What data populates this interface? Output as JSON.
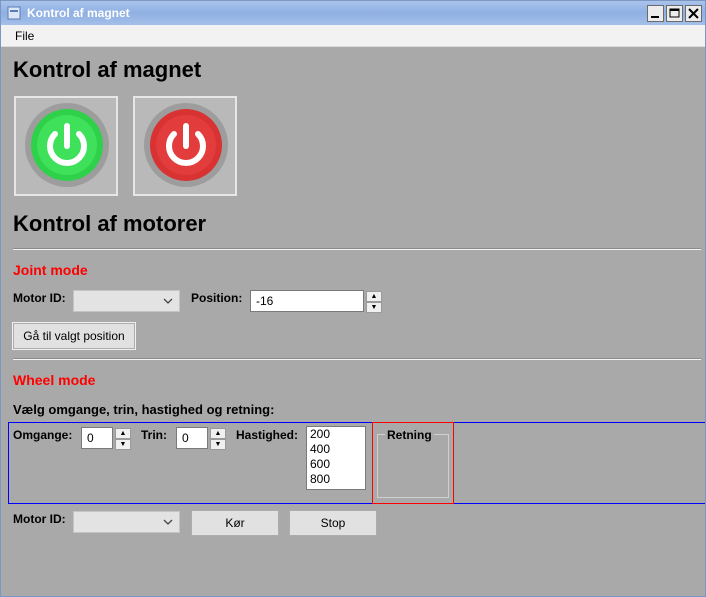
{
  "window": {
    "title": "Kontrol af magnet"
  },
  "menu": {
    "file": "File"
  },
  "magnet": {
    "heading": "Kontrol af magnet",
    "on_color": "#2fd14a",
    "off_color": "#e03a3a"
  },
  "motors": {
    "heading": "Kontrol af motorer"
  },
  "joint": {
    "heading": "Joint mode",
    "motor_id_label": "Motor ID:",
    "position_label": "Position:",
    "position_value": "-16",
    "goto_button": "Gå til valgt position"
  },
  "wheel": {
    "heading": "Wheel mode",
    "instruction": "Vælg omgange, trin, hastighed og retning:",
    "omgange_label": "Omgange:",
    "omgange_value": "0",
    "trin_label": "Trin:",
    "trin_value": "0",
    "hastighed_label": "Hastighed:",
    "speeds": [
      "200",
      "400",
      "600",
      "800"
    ],
    "retning_label": "Retning",
    "motor_id_label": "Motor ID:",
    "run_button": "Kør",
    "stop_button": "Stop"
  }
}
